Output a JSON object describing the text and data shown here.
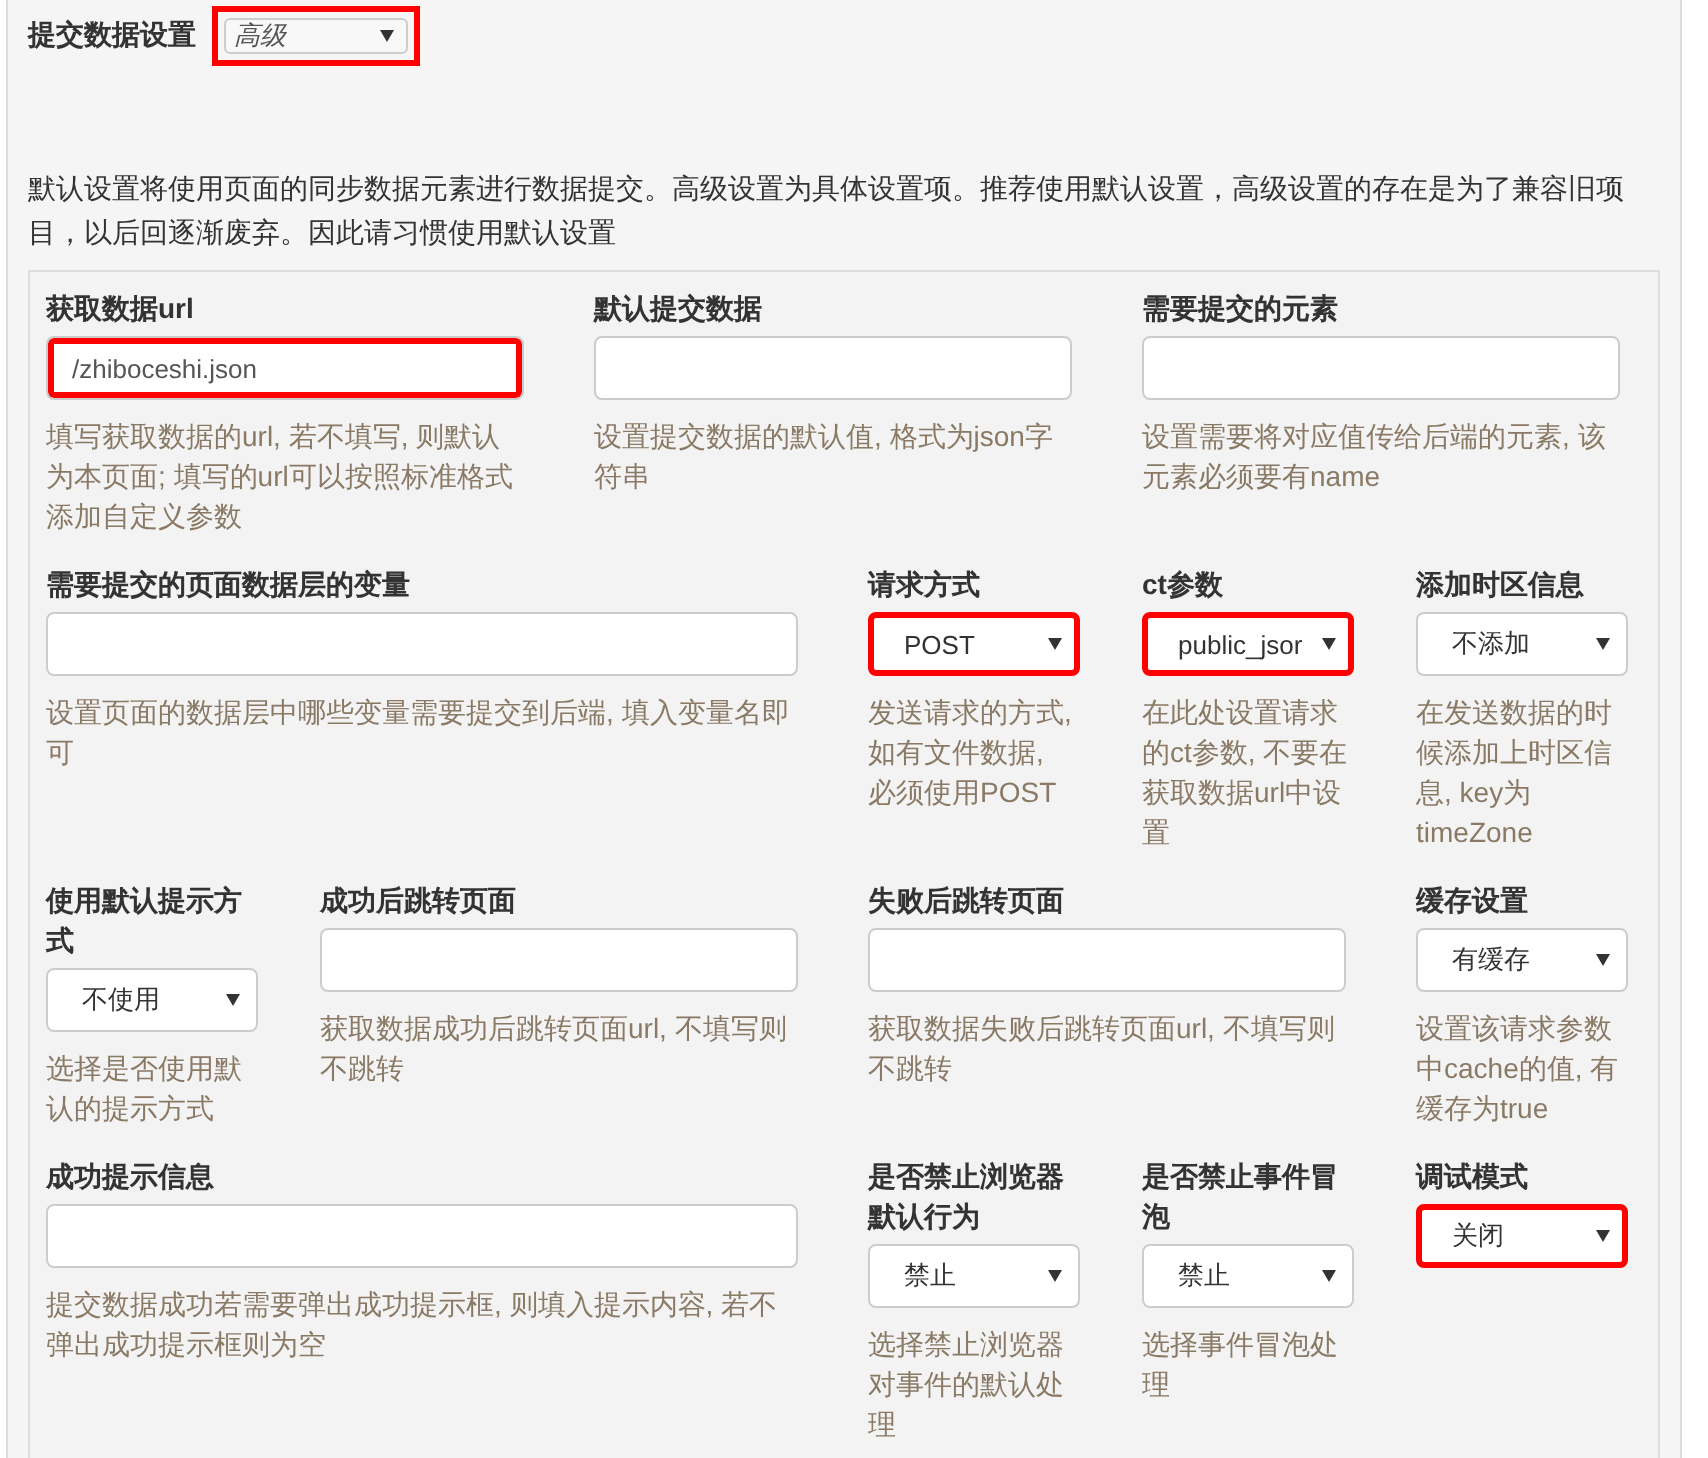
{
  "header": {
    "label": "提交数据设置",
    "select": {
      "value": "高级",
      "highlighted": true
    }
  },
  "description": "默认设置将使用页面的同步数据元素进行数据提交。高级设置为具体设置项。推荐使用默认设置，高级设置的存在是为了兼容旧项目，以后回逐渐废弃。因此请习惯使用默认设置",
  "rows": [
    [
      {
        "kind": "text",
        "label": "获取数据url",
        "value": "/zhiboceshi.json",
        "help": "填写获取数据的url, 若不填写, 则默认为本页面; 填写的url可以按照标准格式添加自定义参数",
        "highlighted": true
      },
      {
        "kind": "text",
        "label": "默认提交数据",
        "help": "设置提交数据的默认值, 格式为json字符串",
        "highlighted": false
      },
      {
        "kind": "text",
        "label": "需要提交的元素",
        "help": "设置需要将对应值传给后端的元素, 该元素必须要有name",
        "highlighted": false
      }
    ],
    [
      {
        "kind": "text",
        "label": "需要提交的页面数据层的变量",
        "help": "设置页面的数据层中哪些变量需要提交到后端, 填入变量名即可",
        "highlighted": false
      },
      {
        "kind": "select",
        "label": "请求方式",
        "value": "POST",
        "help": "发送请求的方式, 如有文件数据, 必须使用POST",
        "highlighted": true
      },
      {
        "kind": "select",
        "label": "ct参数",
        "value": "public_jsor",
        "help": "在此处设置请求的ct参数, 不要在获取数据url中设置",
        "highlighted": true
      },
      {
        "kind": "select",
        "label": "添加时区信息",
        "value": "不添加",
        "help": "在发送数据的时候添加上时区信息, key为timeZone",
        "highlighted": false
      }
    ],
    [
      {
        "kind": "select",
        "label": "使用默认提示方式",
        "value": "不使用",
        "help": "选择是否使用默认的提示方式",
        "highlighted": false
      },
      {
        "kind": "text",
        "label": "成功后跳转页面",
        "help": "获取数据成功后跳转页面url, 不填写则不跳转",
        "highlighted": false
      },
      {
        "kind": "text",
        "label": "失败后跳转页面",
        "help": "获取数据失败后跳转页面url, 不填写则不跳转",
        "highlighted": false
      },
      {
        "kind": "select",
        "label": "缓存设置",
        "value": "有缓存",
        "help": "设置该请求参数中cache的值, 有缓存为true",
        "highlighted": false
      }
    ],
    [
      {
        "kind": "text",
        "label": "成功提示信息",
        "help": "提交数据成功若需要弹出成功提示框, 则填入提示内容, 若不弹出成功提示框则为空",
        "highlighted": false
      },
      {
        "kind": "select",
        "label": "是否禁止浏览器默认行为",
        "value": "禁止",
        "help": "选择禁止浏览器对事件的默认处理",
        "highlighted": false
      },
      {
        "kind": "select",
        "label": "是否禁止事件冒泡",
        "value": "禁止",
        "help": "选择事件冒泡处理",
        "highlighted": false
      },
      {
        "kind": "select",
        "label": "调试模式",
        "value": "关闭",
        "highlighted": true
      }
    ]
  ]
}
